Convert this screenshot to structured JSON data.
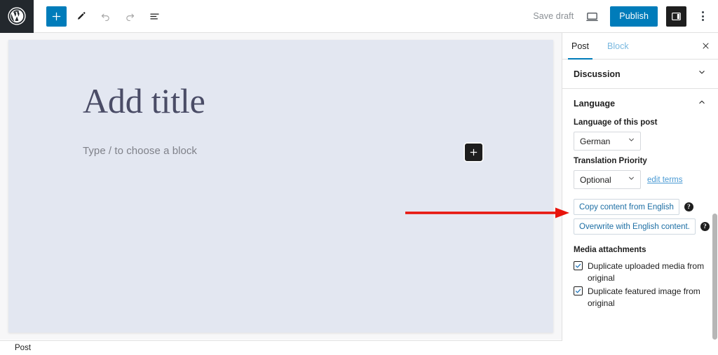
{
  "toolbar": {
    "logo_icon": "wordpress-logo-icon",
    "add_block_label": "+",
    "add_block_icon": "plus-icon",
    "tools_icon": "pencil-icon",
    "undo_icon": "undo-icon",
    "redo_icon": "redo-icon",
    "list_view_icon": "document-overview-icon",
    "save_draft_label": "Save draft",
    "preview_icon": "preview-monitor-icon",
    "publish_label": "Publish",
    "sidebar_toggle_icon": "settings-sidebar-icon",
    "more_menu_icon": "more-vertical-icon",
    "accent_color": "#007cba",
    "logo_bg": "#23282d"
  },
  "editor": {
    "title_placeholder": "Add title",
    "block_placeholder": "Type / to choose a block",
    "inline_add_icon": "plus-icon",
    "canvas_bg": "#e3e7f1"
  },
  "breadcrumb": {
    "item": "Post"
  },
  "sidebar": {
    "tabs": [
      {
        "label": "Post",
        "active": true
      },
      {
        "label": "Block",
        "active": false
      }
    ],
    "close_icon": "close-icon",
    "panels": [
      {
        "title": "Discussion",
        "expanded": false,
        "chevron": "chevron-down-icon"
      },
      {
        "title": "Language",
        "expanded": true,
        "chevron": "chevron-up-icon"
      }
    ],
    "language": {
      "post_language_label": "Language of this post",
      "post_language_value": "German",
      "translation_priority_label": "Translation Priority",
      "translation_priority_value": "Optional",
      "edit_terms_link": "edit terms",
      "chevron_icon": "chevron-down-icon",
      "copy_button": "Copy content from English",
      "copy_help_icon": "help-icon",
      "overwrite_button": "Overwrite with English content.",
      "overwrite_help_icon": "help-icon",
      "help_glyph": "?"
    },
    "media": {
      "section_title": "Media attachments",
      "checkboxes": [
        {
          "label": "Duplicate uploaded media from original",
          "checked": true
        },
        {
          "label": "Duplicate featured image from original",
          "checked": true
        }
      ],
      "check_icon": "checkmark-icon"
    },
    "link_color": "#4a9ad4"
  },
  "annotation": {
    "arrow_icon": "red-arrow-right-icon",
    "color": "#e8140c"
  }
}
